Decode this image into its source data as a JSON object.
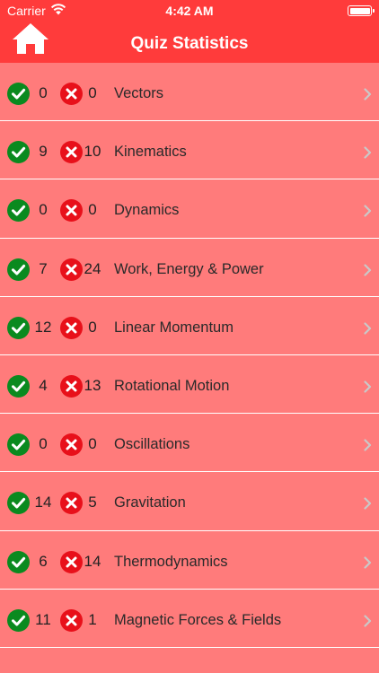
{
  "status": {
    "carrier": "Carrier",
    "time": "4:42 AM"
  },
  "header": {
    "title": "Quiz Statistics"
  },
  "colors": {
    "header": "#ff3b3b",
    "background": "#ff7b7b",
    "correct": "#0a8a1f",
    "wrong": "#e8101a"
  },
  "icons": {
    "home": "home-icon",
    "correct": "check-circle-icon",
    "wrong": "x-circle-icon",
    "chevron": "chevron-right-icon"
  },
  "rows": [
    {
      "correct": "0",
      "wrong": "0",
      "label": "Vectors"
    },
    {
      "correct": "9",
      "wrong": "10",
      "label": "Kinematics"
    },
    {
      "correct": "0",
      "wrong": "0",
      "label": "Dynamics"
    },
    {
      "correct": "7",
      "wrong": "24",
      "label": "Work, Energy & Power"
    },
    {
      "correct": "12",
      "wrong": "0",
      "label": "Linear Momentum"
    },
    {
      "correct": "4",
      "wrong": "13",
      "label": "Rotational Motion"
    },
    {
      "correct": "0",
      "wrong": "0",
      "label": "Oscillations"
    },
    {
      "correct": "14",
      "wrong": "5",
      "label": "Gravitation"
    },
    {
      "correct": "6",
      "wrong": "14",
      "label": "Thermodynamics"
    },
    {
      "correct": "11",
      "wrong": "1",
      "label": "Magnetic Forces & Fields"
    }
  ]
}
